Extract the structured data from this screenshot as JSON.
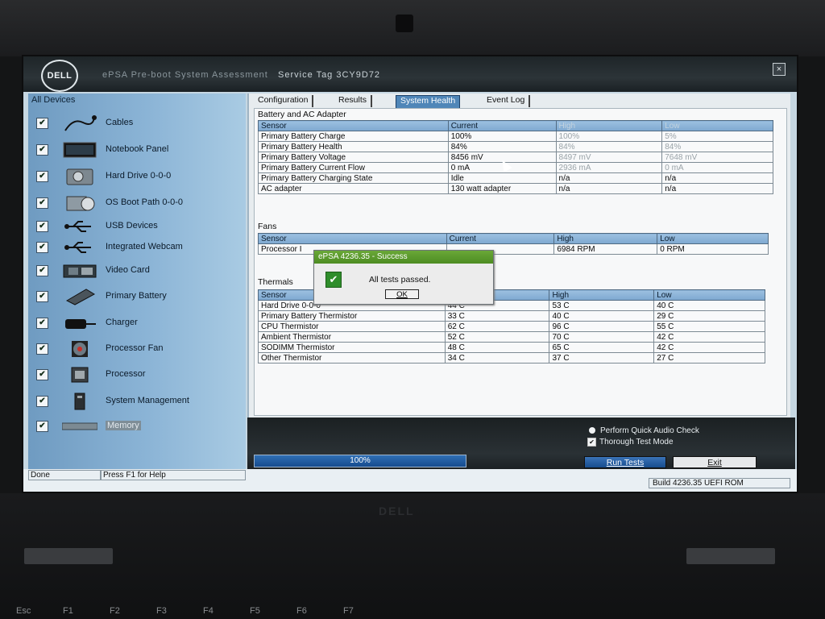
{
  "app": {
    "logo_text": "DELL",
    "title": "ePSA Pre-boot System Assessment",
    "service_tag": "Service Tag 3CY9D72",
    "close_glyph": "×"
  },
  "sidebar": {
    "header": "All Devices",
    "check_glyph": "✔",
    "devices": [
      {
        "label": "Cables",
        "icon": "cable-icon"
      },
      {
        "label": "Notebook Panel",
        "icon": "monitor-icon"
      },
      {
        "label": "Hard Drive 0-0-0",
        "icon": "hard-drive-icon"
      },
      {
        "label": "OS Boot Path 0-0-0",
        "icon": "boot-path-icon"
      },
      {
        "label": "USB Devices",
        "icon": "usb-icon"
      },
      {
        "label": "Integrated Webcam",
        "icon": "usb-icon"
      },
      {
        "label": "Video Card",
        "icon": "video-card-icon"
      },
      {
        "label": "Primary Battery",
        "icon": "battery-icon"
      },
      {
        "label": "Charger",
        "icon": "charger-icon"
      },
      {
        "label": "Processor Fan",
        "icon": "fan-icon"
      },
      {
        "label": "Processor",
        "icon": "cpu-icon"
      },
      {
        "label": "System Management",
        "icon": "system-management-icon"
      },
      {
        "label": "Memory",
        "icon": "memory-icon"
      }
    ]
  },
  "tabs": [
    "Configuration",
    "Results",
    "System Health",
    "Event Log"
  ],
  "active_tab": "System Health",
  "battery": {
    "title": "Battery and AC Adapter",
    "headers": [
      "Sensor",
      "Current",
      "High",
      "Low"
    ],
    "rows": [
      [
        "Primary Battery Charge",
        "100%",
        "100%",
        "5%"
      ],
      [
        "Primary Battery Health",
        "84%",
        "84%",
        "84%"
      ],
      [
        "Primary Battery Voltage",
        "8456 mV",
        "8497 mV",
        "7648 mV"
      ],
      [
        "Primary Battery Current Flow",
        "0 mA",
        "2936 mA",
        "0 mA"
      ],
      [
        "Primary Battery Charging State",
        "Idle",
        "n/a",
        "n/a"
      ],
      [
        "AC adapter",
        "130 watt adapter",
        "n/a",
        "n/a"
      ]
    ]
  },
  "fans": {
    "title": "Fans",
    "headers": [
      "Sensor",
      "Current",
      "High",
      "Low"
    ],
    "rows": [
      [
        "Processor I",
        "",
        "6984 RPM",
        "0 RPM"
      ]
    ]
  },
  "thermals": {
    "title": "Thermals",
    "headers": [
      "Sensor",
      "",
      "High",
      "Low"
    ],
    "rows": [
      [
        "Hard Drive 0-0-0",
        "44 C",
        "53 C",
        "40 C"
      ],
      [
        "Primary Battery Thermistor",
        "33 C",
        "40 C",
        "29 C"
      ],
      [
        "CPU Thermistor",
        "62 C",
        "96 C",
        "55 C"
      ],
      [
        "Ambient Thermistor",
        "52 C",
        "70 C",
        "42 C"
      ],
      [
        "SODIMM Thermistor",
        "48 C",
        "65 C",
        "42 C"
      ],
      [
        "Other Thermistor",
        "34 C",
        "37 C",
        "27 C"
      ]
    ]
  },
  "dialog": {
    "title": "ePSA 4236.35 - Success",
    "icon_glyph": "✔",
    "message": "All tests passed.",
    "ok_label": "OK"
  },
  "progress": {
    "label": "100%",
    "value": 1.0
  },
  "options": {
    "quick_audio_label": "Perform Quick Audio Check",
    "thorough_label": "Thorough Test Mode",
    "check_glyph": "✔"
  },
  "buttons": {
    "run_tests": "Run Tests",
    "exit": "Exit"
  },
  "status": {
    "state": "Done",
    "help": "Press F1 for Help",
    "build": "Build 4236.35 UEFI ROM"
  },
  "hardware": {
    "brand": "DELL",
    "keys": [
      "Esc",
      "F1",
      "F2",
      "F3",
      "F4",
      "F5",
      "F6",
      "F7"
    ]
  }
}
